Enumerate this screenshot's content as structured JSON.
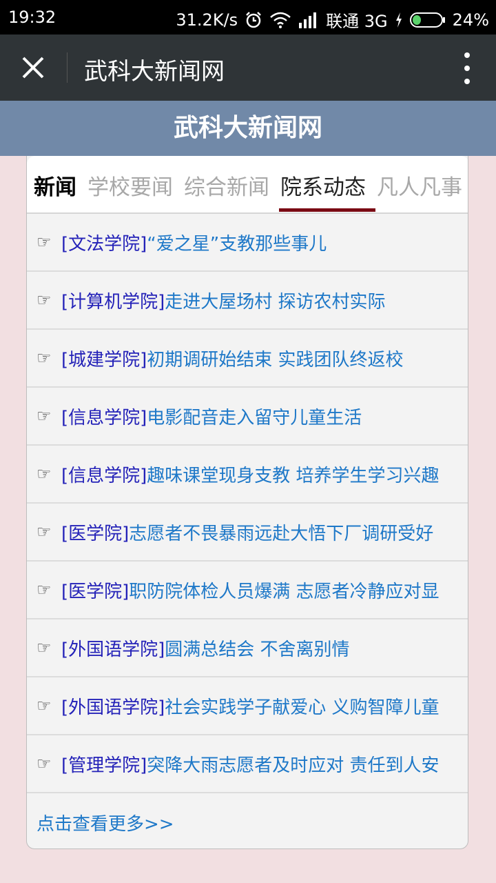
{
  "status_bar": {
    "time": "19:32",
    "net_speed": "31.2K/s",
    "carrier": "联通 3G",
    "battery": "24%"
  },
  "titlebar": {
    "title": "武科大新闻网"
  },
  "banner": {
    "title": "武科大新闻网"
  },
  "tabs": [
    {
      "label": "新闻"
    },
    {
      "label": "学校要闻"
    },
    {
      "label": "综合新闻"
    },
    {
      "label": "院系动态",
      "active": true
    },
    {
      "label": "凡人凡事"
    }
  ],
  "news": [
    {
      "category": "[文法学院]",
      "headline": " “爱之星”支教那些事儿"
    },
    {
      "category": "[计算机学院]",
      "headline": "走进大屋场村 探访农村实际"
    },
    {
      "category": "[城建学院]",
      "headline": "初期调研始结束 实践团队终返校"
    },
    {
      "category": "[信息学院]",
      "headline": "电影配音走入留守儿童生活"
    },
    {
      "category": "[信息学院]",
      "headline": "趣味课堂现身支教 培养学生学习兴趣"
    },
    {
      "category": "[医学院]",
      "headline": "志愿者不畏暴雨远赴大悟下厂调研受好"
    },
    {
      "category": "[医学院]",
      "headline": "职防院体检人员爆满 志愿者冷静应对显"
    },
    {
      "category": "[外国语学院]",
      "headline": "圆满总结会 不舍离别情"
    },
    {
      "category": "[外国语学院]",
      "headline": "社会实践学子献爱心 义购智障儿童"
    },
    {
      "category": "[管理学院]",
      "headline": "突降大雨志愿者及时应对 责任到人安"
    }
  ],
  "bullet_glyph": "☞",
  "more_link": "点击查看更多>>",
  "colors": {
    "banner_bg": "#7189a8",
    "page_bg": "#f2dfe1",
    "category_text": "#2422b8",
    "headline_text": "#1e78c8",
    "active_tab_underline": "#7a0a14"
  }
}
